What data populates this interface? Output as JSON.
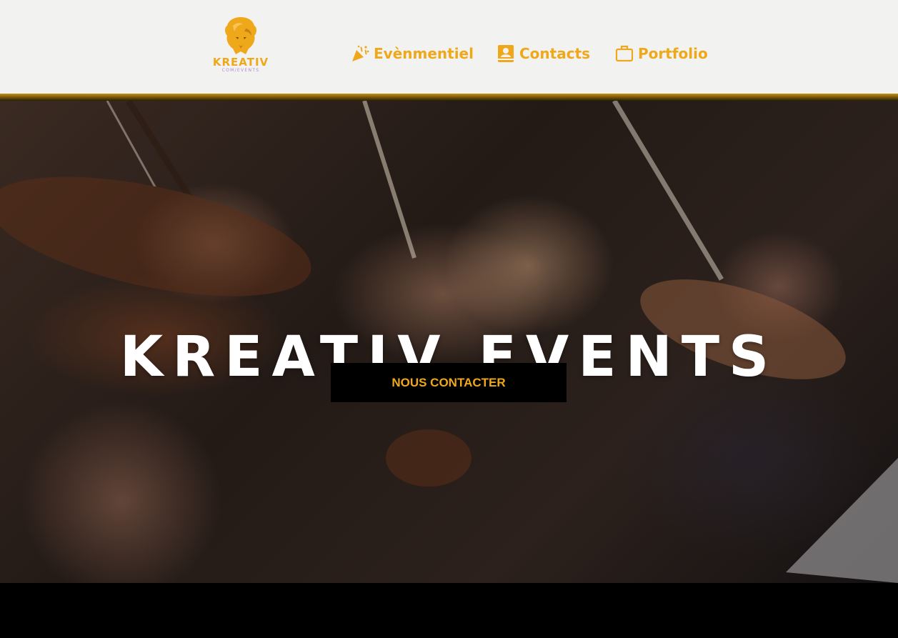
{
  "brand": {
    "logo_text": "KREATIV",
    "logo_subtext": "COM/EVENTS",
    "logo_icon": "lion-head-icon",
    "accent_color": "#f0a81b"
  },
  "nav": {
    "items": [
      {
        "label": "Evènmentiel",
        "icon": "party-popper-icon"
      },
      {
        "label": "Contacts",
        "icon": "contact-book-icon"
      },
      {
        "label": "Portfolio",
        "icon": "briefcase-icon"
      }
    ]
  },
  "hero": {
    "title": "KREATIV EVENTS",
    "cta_label": "NOUS CONTACTER"
  }
}
